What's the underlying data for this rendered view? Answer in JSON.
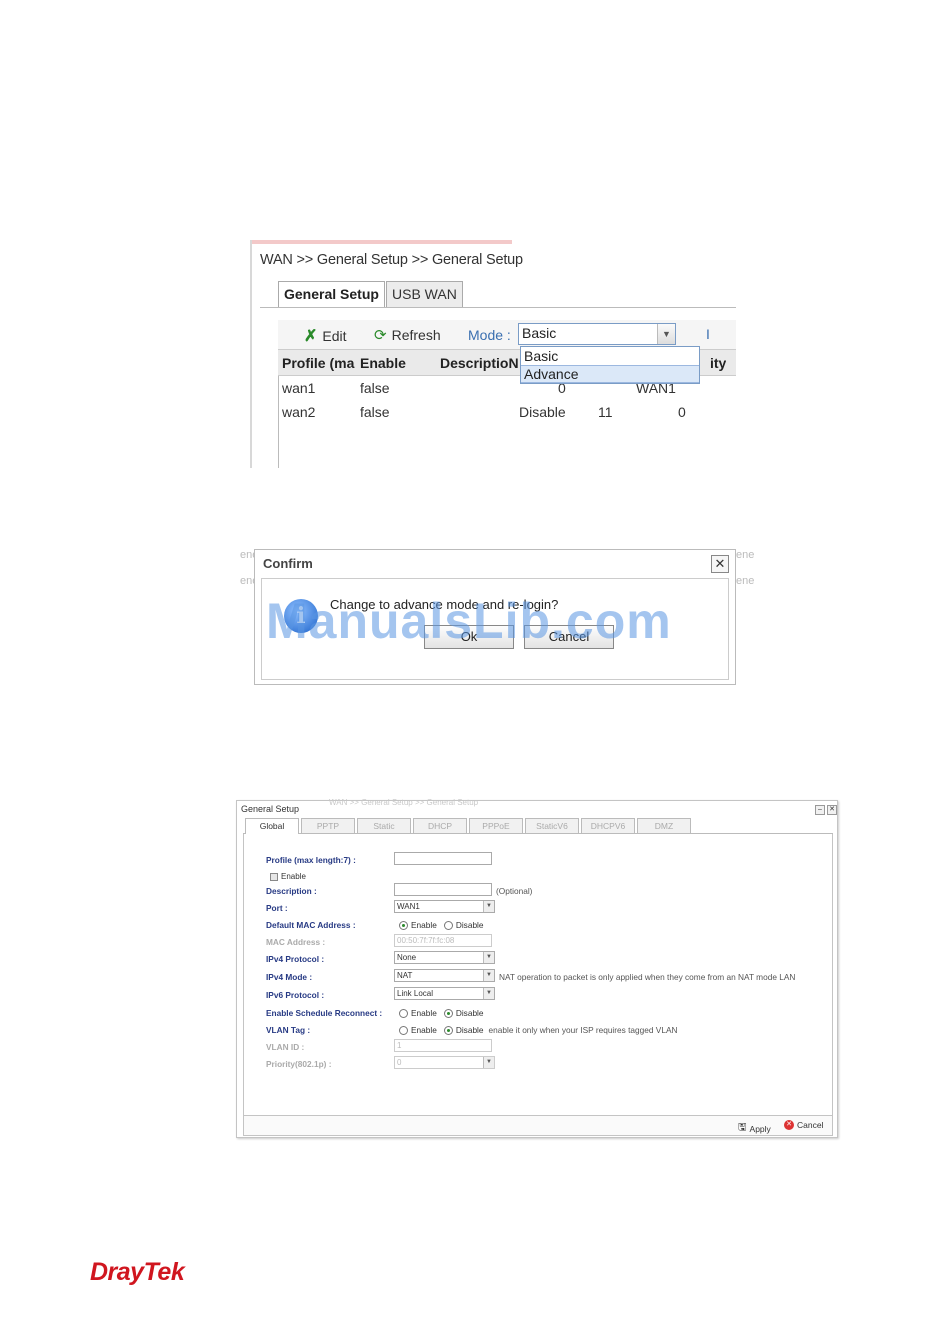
{
  "shot1": {
    "breadcrumb": "WAN >> General Setup >> General Setup",
    "tabs": [
      "General Setup",
      "USB WAN"
    ],
    "toolbar": {
      "edit": "Edit",
      "refresh": "Refresh",
      "mode_label": "Mode :",
      "mode_value": "Basic",
      "extra": "I"
    },
    "dropdown_options": [
      "Basic",
      "Advance"
    ],
    "columns": [
      "Profile (ma",
      "Enable",
      "DescriptioN",
      "ity"
    ],
    "rows": [
      {
        "profile": "wan1",
        "enable": "false",
        "c3": "0",
        "c4": "WAN1"
      },
      {
        "profile": "wan2",
        "enable": "false",
        "c3": "Disable",
        "c4": "11",
        "c5": "0"
      }
    ]
  },
  "shot2": {
    "title": "Confirm",
    "message": "Change to advance mode and re-login?",
    "ok": "Ok",
    "cancel": "Cancel",
    "watermark": "ManualsLib.com",
    "ghost_left": "ene",
    "ghost_left2": "ene",
    "ghost_right": "ene",
    "ghost_right2": "ene"
  },
  "shot3": {
    "title": "General Setup",
    "breadcrumb": "WAN >> General Setup >> General Setup",
    "tabs": [
      "Global",
      "PPTP",
      "Static",
      "DHCP",
      "PPPoE",
      "StaticV6",
      "DHCPV6",
      "DMZ"
    ],
    "fields": {
      "profile_label": "Profile (max length:7) :",
      "enable_label": "Enable",
      "description_label": "Description :",
      "description_note": "(Optional)",
      "port_label": "Port :",
      "port_value": "WAN1",
      "default_mac_label": "Default MAC Address :",
      "mac_address_label": "MAC Address :",
      "mac_address_value": "00:50:7f:7f:fc:08",
      "ipv4_protocol_label": "IPv4 Protocol :",
      "ipv4_protocol_value": "None",
      "ipv4_mode_label": "IPv4 Mode :",
      "ipv4_mode_value": "NAT",
      "ipv4_mode_note": "NAT operation to packet is only applied when they come from an NAT mode LAN",
      "ipv6_protocol_label": "IPv6 Protocol :",
      "ipv6_protocol_value": "Link Local",
      "schedule_label": "Enable Schedule Reconnect :",
      "vlan_tag_label": "VLAN Tag :",
      "vlan_tag_note": "enable it only when your ISP requires tagged VLAN",
      "vlan_id_label": "VLAN ID :",
      "vlan_id_value": "1",
      "priority_label": "Priority(802.1p) :",
      "priority_value": "0",
      "opt_enable": "Enable",
      "opt_disable": "Disable"
    },
    "footer": {
      "apply": "Apply",
      "cancel": "Cancel"
    }
  },
  "logo": "DrayTek"
}
